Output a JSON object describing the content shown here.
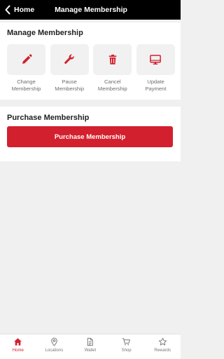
{
  "header": {
    "back_label": "Home",
    "title": "Manage Membership"
  },
  "manage_section": {
    "title": "Manage Membership",
    "actions": [
      {
        "label": "Change\nMembership",
        "icon": "pencil-icon"
      },
      {
        "label": "Pause\nMembership",
        "icon": "wrench-icon"
      },
      {
        "label": "Cancel\nMembership",
        "icon": "trash-icon"
      },
      {
        "label": "Update\nPayment",
        "icon": "monitor-icon"
      }
    ]
  },
  "purchase_section": {
    "title": "Purchase Membership",
    "button_label": "Purchase Membership"
  },
  "tabbar": {
    "tabs": [
      {
        "label": "Home",
        "icon": "home-icon",
        "active": true
      },
      {
        "label": "Locations",
        "icon": "location-pin-icon",
        "active": false
      },
      {
        "label": "Wallet",
        "icon": "document-icon",
        "active": false
      },
      {
        "label": "Shop",
        "icon": "cart-icon",
        "active": false
      },
      {
        "label": "Rewards",
        "icon": "star-icon",
        "active": false
      }
    ]
  },
  "colors": {
    "accent": "#d3202e",
    "header_bg": "#000000",
    "page_bg": "#f0f0f0",
    "action_tile_bg": "#f1f1f1",
    "inactive": "#777777"
  }
}
